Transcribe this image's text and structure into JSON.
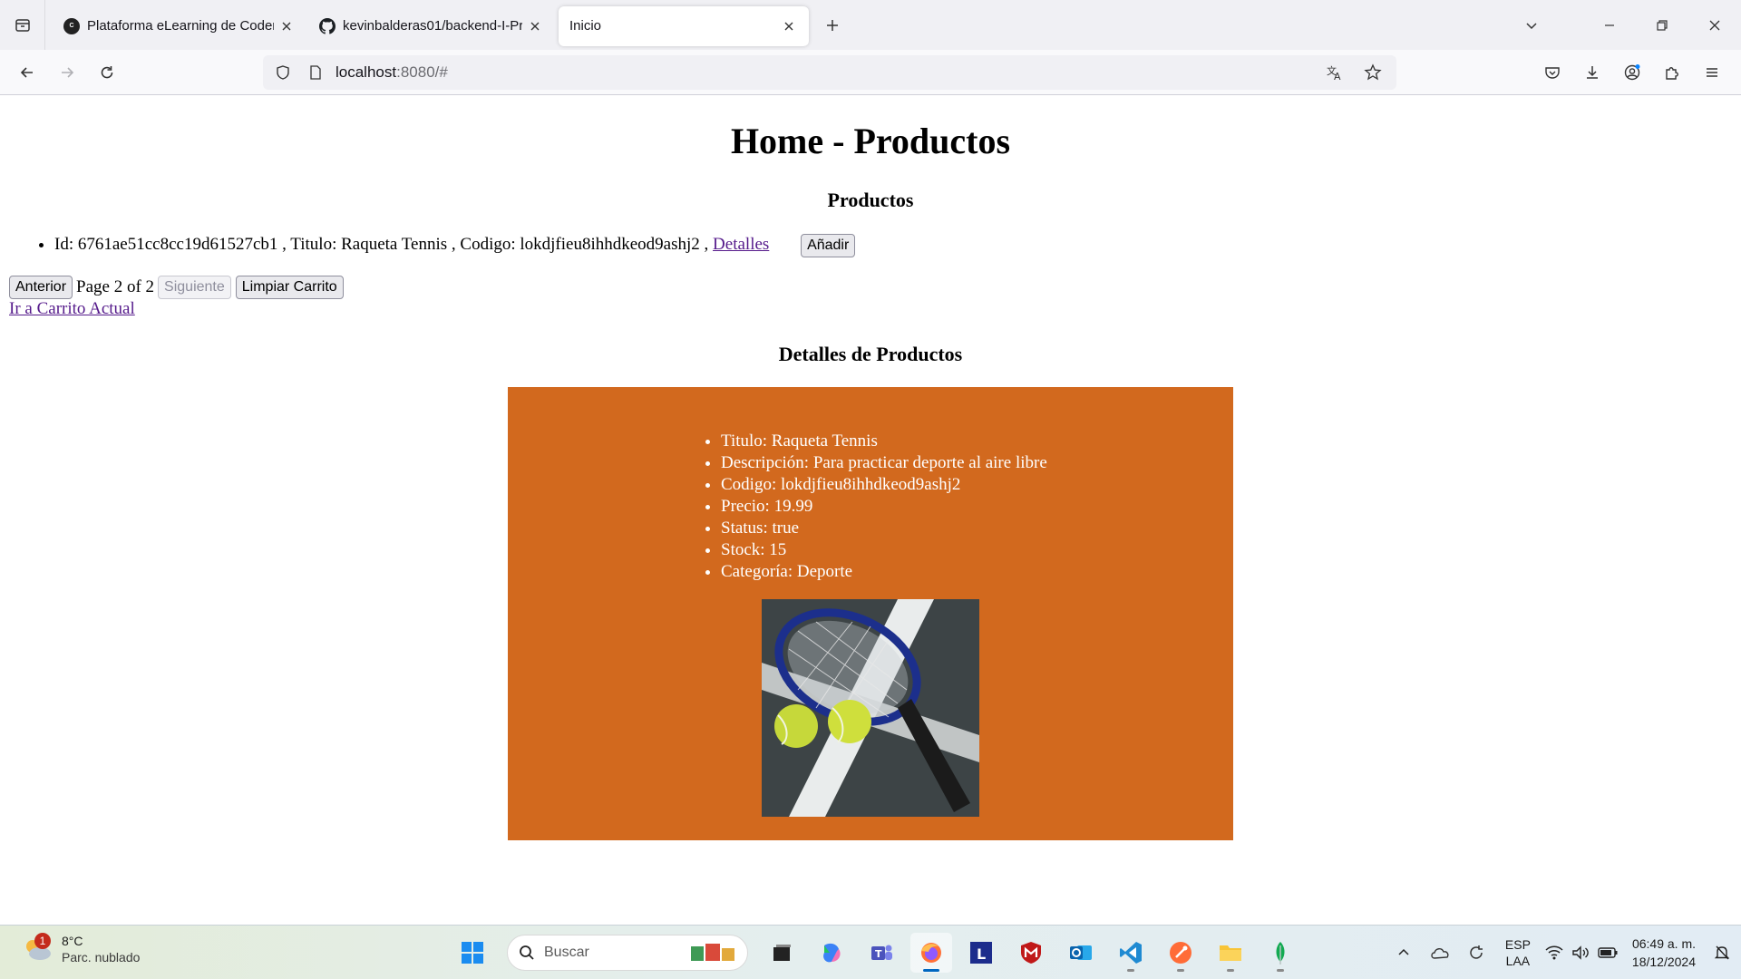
{
  "browser": {
    "tabs": [
      {
        "title": "Plataforma eLearning de Coder",
        "active": false
      },
      {
        "title": "kevinbalderas01/backend-I-Pro",
        "active": false
      },
      {
        "title": "Inicio",
        "active": true
      }
    ],
    "url_host": "localhost",
    "url_path": ":8080/#"
  },
  "page": {
    "title": "Home - Productos",
    "products_heading": "Productos",
    "products": [
      {
        "id_label": "Id: 6761ae51cc8cc19d61527cb1 , Titulo: Raqueta Tennis , Codigo: lokdjfieu8ihhdkeod9ashj2 ,",
        "details_link": "Detalles",
        "add_button": "Añadir"
      }
    ],
    "pager": {
      "prev": "Anterior",
      "status": "Page 2 of 2",
      "next": "Siguiente",
      "clear": "Limpiar Carrito"
    },
    "cart_link": "Ir a Carrito Actual",
    "details_heading": "Detalles de Productos",
    "details": [
      "Titulo: Raqueta Tennis",
      "Descripción: Para practicar deporte al aire libre",
      "Codigo: lokdjfieu8ihhdkeod9ashj2",
      "Precio: 19.99",
      "Status: true",
      "Stock: 15",
      "Categoría: Deporte"
    ],
    "details_bg": "#d2691e"
  },
  "taskbar": {
    "weather_temp": "8°C",
    "weather_desc": "Parc. nublado",
    "weather_badge": "1",
    "search_placeholder": "Buscar",
    "lang_1": "ESP",
    "lang_2": "LAA",
    "time": "06:49 a. m.",
    "date": "18/12/2024"
  }
}
